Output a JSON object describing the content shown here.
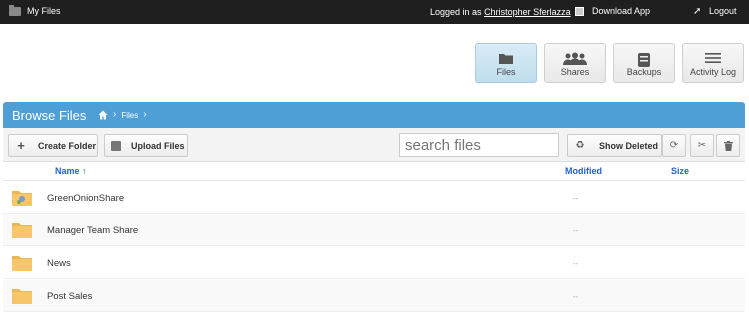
{
  "topbar": {
    "app_title": "My Files",
    "logged_prefix": "Logged in as",
    "user_name": "Christopher Sferlazza",
    "download_label": "Download App",
    "logout_label": "Logout"
  },
  "nav": {
    "files": "Files",
    "shares": "Shares",
    "backups": "Backups",
    "activity": "Activity Log"
  },
  "header": {
    "title": "Browse Files",
    "crumb": "Files"
  },
  "toolbar": {
    "create_folder": "Create Folder",
    "upload_files": "Upload Files",
    "search_placeholder": "search files",
    "show_deleted": "Show Deleted"
  },
  "columns": {
    "name": "Name ↑",
    "modified": "Modified",
    "size": "Size"
  },
  "rows": [
    {
      "name": "GreenOnionShare",
      "modified": "--"
    },
    {
      "name": "Manager Team Share",
      "modified": "--"
    },
    {
      "name": "News",
      "modified": "--"
    },
    {
      "name": "Post Sales",
      "modified": "--"
    }
  ],
  "colors": {
    "header_blue": "#4e9fd6",
    "topbar": "#1f1f1f",
    "link_blue": "#2563c9",
    "folder": "#f6c66b"
  },
  "icons": {
    "brand": "folder-icon",
    "download": "download-icon",
    "logout": "logout-arrow-icon",
    "home": "home-icon",
    "refresh": "refresh-icon",
    "cut": "scissors-icon",
    "delete": "trash-icon",
    "recycle": "recycle-icon"
  }
}
